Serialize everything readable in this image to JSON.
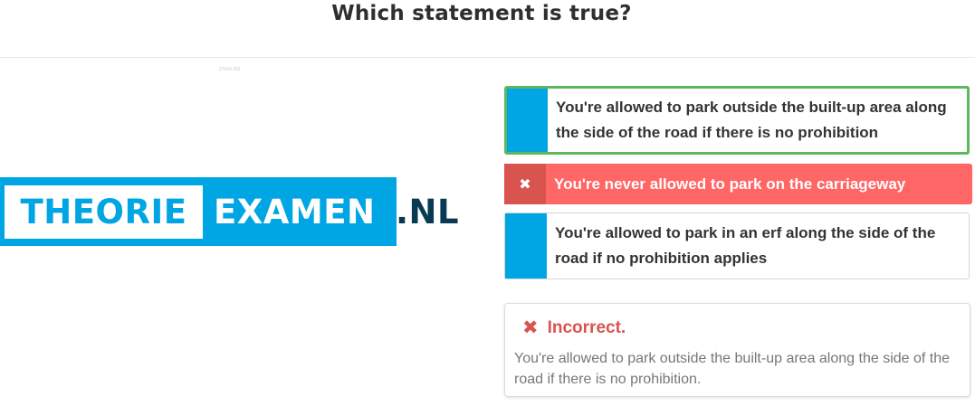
{
  "question": {
    "title": "Which statement is true?",
    "image_caption": "27644-351"
  },
  "logo": {
    "part1": "THEORIE",
    "part2": "EXAMEN",
    "tld": ".NL",
    "colors": {
      "blue": "#00a5e3",
      "dark": "#0a3a52"
    }
  },
  "answers": [
    {
      "text": "You're allowed to park outside the built-up area along the side of the road if there is no prohibition",
      "state": "correct"
    },
    {
      "text": "You're never allowed to park on the carriageway",
      "state": "selected-wrong",
      "marker_icon": "close-icon",
      "marker_glyph": "✖"
    },
    {
      "text": "You're allowed to park in an erf along the side of the road if no prohibition applies",
      "state": "neutral"
    }
  ],
  "feedback": {
    "icon": "close-icon",
    "glyph": "✖",
    "title": "Incorrect.",
    "body": "You're allowed to park outside the built-up area along the side of the road if there is no prohibition."
  },
  "colors": {
    "correct_border": "#5cb85c",
    "wrong_bg": "#ff6666",
    "wrong_marker": "#d9534f",
    "marker_blue": "#00a5e3"
  }
}
